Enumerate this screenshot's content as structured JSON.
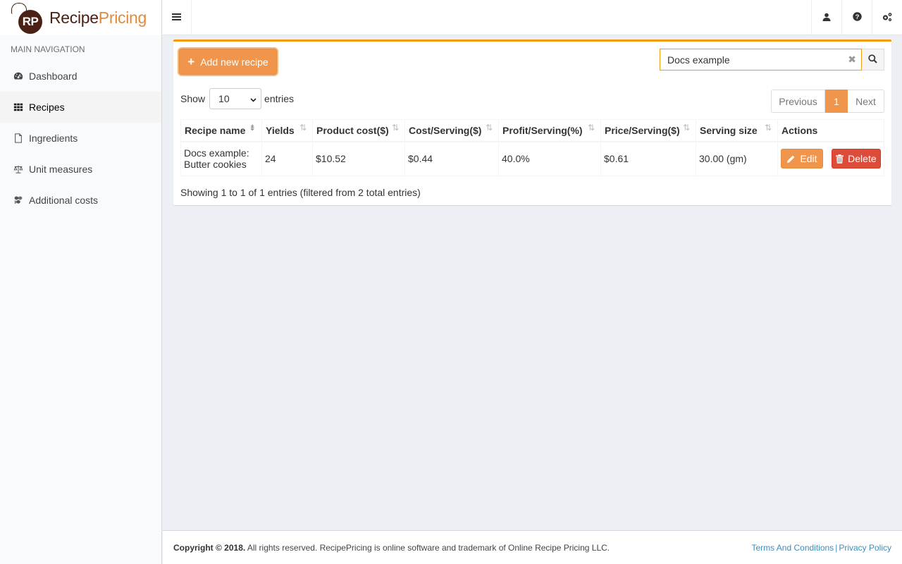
{
  "brand": {
    "initials": "RP",
    "name_part1": "Recipe",
    "name_part2": "Pricing"
  },
  "sidebar": {
    "header": "MAIN NAVIGATION",
    "items": [
      {
        "label": "Dashboard",
        "icon": "dashboard-icon"
      },
      {
        "label": "Recipes",
        "icon": "grid-icon",
        "active": true
      },
      {
        "label": "Ingredients",
        "icon": "file-icon"
      },
      {
        "label": "Unit measures",
        "icon": "balance-scale-icon"
      },
      {
        "label": "Additional costs",
        "icon": "cubes-icon"
      }
    ]
  },
  "topbar": {
    "icons": [
      "user-icon",
      "question-icon",
      "cogs-icon"
    ]
  },
  "toolbar": {
    "add_label": "Add new recipe"
  },
  "search": {
    "value": "Docs example",
    "clear": "✖"
  },
  "table_controls": {
    "show_label": "Show",
    "page_length": "10",
    "entries_label": "entries"
  },
  "pagination": {
    "previous": "Previous",
    "current": "1",
    "next": "Next"
  },
  "table": {
    "headers": [
      "Recipe name",
      "Yields",
      "Product cost($)",
      "Cost/Serving($)",
      "Profit/Serving(%)",
      "Price/Serving($)",
      "Serving size",
      "Actions"
    ],
    "rows": [
      {
        "name_line1": "Docs example:",
        "name_line2": "Butter cookies",
        "yields": "24",
        "product_cost": "$10.52",
        "cost_serving": "$0.44",
        "profit_serving": "40.0%",
        "price_serving": "$0.61",
        "serving_size": "30.00 (gm)",
        "edit_label": "Edit",
        "delete_label": "Delete"
      }
    ]
  },
  "table_info": "Showing 1 to 1 of 1 entries (filtered from 2 total entries)",
  "footer": {
    "copyright_bold": "Copyright © 2018.",
    "copyright_rest": " All rights reserved. RecipePricing is online software and trademark of Online Recipe Pricing LLC.",
    "terms": "Terms And Conditions",
    "separator": "|",
    "privacy": "Privacy Policy"
  },
  "colors": {
    "accent": "#f0964c",
    "danger": "#dd4b39",
    "link": "#3c8dbc",
    "brand": "#4a2215"
  }
}
